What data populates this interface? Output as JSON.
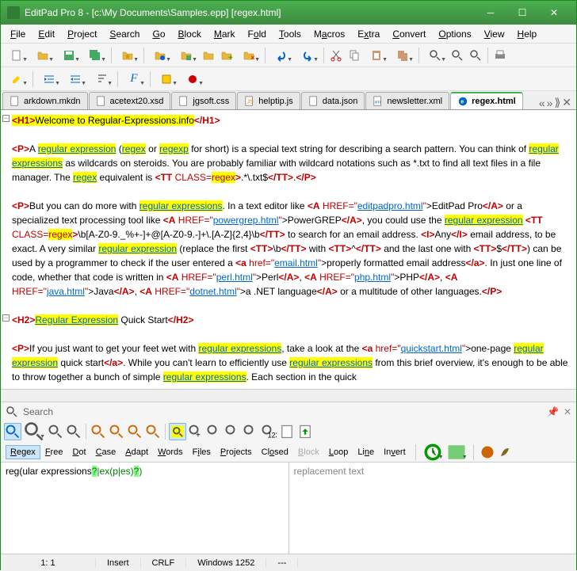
{
  "title": "EditPad Pro 8 - [c:\\My Documents\\Samples.epp] [regex.html]",
  "menu": [
    "File",
    "Edit",
    "Project",
    "Search",
    "Go",
    "Block",
    "Mark",
    "Fold",
    "Tools",
    "Macros",
    "Extra",
    "Convert",
    "Options",
    "View",
    "Help"
  ],
  "tabs": [
    {
      "label": "arkdown.mkdn",
      "active": false
    },
    {
      "label": "acetext20.xsd",
      "active": false
    },
    {
      "label": "jgsoft.css",
      "active": false
    },
    {
      "label": "helptip.js",
      "active": false
    },
    {
      "label": "data.json",
      "active": false
    },
    {
      "label": "newsletter.xml",
      "active": false
    },
    {
      "label": "regex.html",
      "active": true
    }
  ],
  "doc": {
    "h1_open": "<H1>",
    "h1_text": "Welcome to Regular-Expressions.info",
    "h1_close": "</H1>",
    "p": "<P>",
    "pc": "</P>",
    "a_open": "<A",
    "a_c": "</A>",
    "a2": "<a",
    "a2c": "</a>",
    "i": "<I>",
    "ic": "</I>",
    "tt": "<TT",
    "ttc": "</TT>",
    "h2": "<H2>",
    "h2c": "</H2>",
    "txt_a": "A ",
    "re": "regular expression",
    "lp": " (",
    "regex": "regex",
    "or": " or ",
    "regexp": "regexp",
    "s1": " for short) is a special text string for describing a search pattern.  You can think of ",
    "res": "regular expressions",
    "s2": " as wildcards on steroids.  You are probably familiar with wildcard notations such as *.txt to find all text files in a file manager.  The ",
    "s3": " equivalent is ",
    " cls": " CLASS=",
    "rxv": "regex",
    "gt": ">",
    "pat1": ".*\\.txt$",
    "dot": ".",
    "s4": "But you can do more with ",
    "s5": ".  In a text editor like ",
    " href": " HREF=\"",
    "q": "\"",
    "l_epp": "editpadpro.html",
    "t_epp": ">EditPad Pro",
    "s6": " or a specialized text processing tool like ",
    "l_pg": "powergrep.html",
    "t_pg": ">PowerGREP",
    "s7": ", you could use the ",
    "pat2": "\\b[A-Z0-9._%+-]+@[A-Z0-9.-]+\\.[A-Z]{2,4}\\b",
    "s8": " to search for an email address.  ",
    "any": "Any",
    "s9": " email address, to be exact.  A very similar ",
    "s10": " (replace the first ",
    "bs": "\\b",
    "s11": " with ",
    "caret": "^",
    "s12": " and the last one with ",
    "dollar": "$",
    "s13": ") can be used by a programmer to check if the user entered a ",
    "href2": " href=\"",
    "l_em": "email.html",
    "t_em": ">properly formatted email address",
    "s14": ".  In just one line of code, whether that code is written in ",
    "l_pl": "perl.html",
    "t_pl": ">Perl",
    "cm": ", ",
    "l_php": "php.html",
    "t_php": ">PHP",
    "l_jv": "java.html",
    "t_jv": ">Java",
    "l_dn": "dotnet.html",
    "t_dn": ">a .NET language",
    "s15": " or a multitude of other languages.",
    "reqs": "Regular Expression",
    "qs": " Quick Start",
    "s16": "If you just want to get your feet wet with ",
    "s17": ", take a look at the ",
    "l_qs": "quickstart.html",
    "t_qs": ">one-page ",
    "s18": " quick start",
    "s19": ".  While you can't learn to efficiently use ",
    "s20": " from this brief overview, it's enough to be able to throw together a bunch of simple ",
    "s21": ".  Each section in the quick"
  },
  "search_label": "Search",
  "search_opts": [
    "Regex",
    "Free",
    "Dot",
    "Case",
    "Adapt",
    "Words",
    "Files",
    "Projects",
    "Closed",
    "Block",
    "Loop",
    "Line",
    "Invert"
  ],
  "regex_input": {
    "pre": "reg(ular expressions",
    "q1": "?",
    "mid": "|ex(p|es)",
    "q2": "?",
    "end": ")"
  },
  "replace_input": "replacement text",
  "status": {
    "pos": "1: 1",
    "mode": "Insert",
    "eol": "CRLF",
    "enc": "Windows 1252",
    "extra": "---"
  }
}
